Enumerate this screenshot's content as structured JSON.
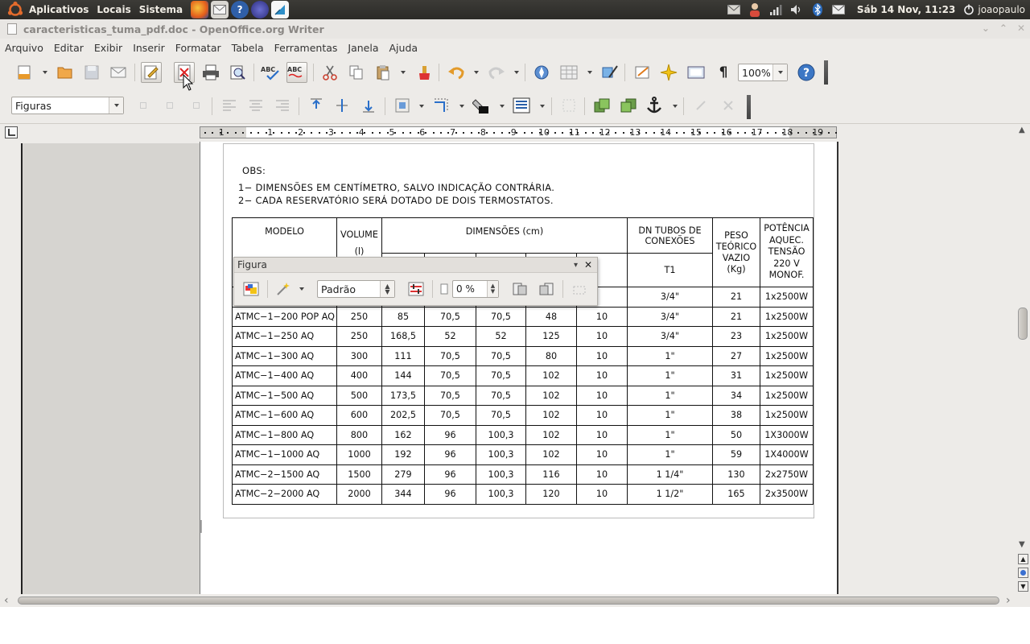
{
  "top_panel": {
    "menus": [
      "Aplicativos",
      "Locais",
      "Sistema"
    ],
    "datetime": "Sáb 14 Nov, 11:23",
    "user": "joaopaulo"
  },
  "window": {
    "title": "caracteristicas_tuma_pdf.doc - OpenOffice.org Writer"
  },
  "menubar": [
    "Arquivo",
    "Editar",
    "Exibir",
    "Inserir",
    "Formatar",
    "Tabela",
    "Ferramentas",
    "Janela",
    "Ajuda"
  ],
  "toolbar": {
    "zoom": "100%"
  },
  "frame_toolbar": {
    "style_value": "Figuras"
  },
  "ruler": {
    "numbers": [
      "1",
      "1",
      "2",
      "3",
      "4",
      "5",
      "6",
      "7",
      "8",
      "9",
      "10",
      "11",
      "12",
      "13",
      "14",
      "15",
      "16",
      "17",
      "18",
      "19"
    ]
  },
  "document": {
    "obs_title": "OBS:",
    "obs_lines": [
      "1− DIMENSÕES EM CENTÍMETRO, SALVO INDICAÇÃO CONTRÁRIA.",
      "2− CADA RESERVATÓRIO SERÁ DOTADO DE DOIS TERMOSTATOS."
    ],
    "headers": {
      "modelo": "MODELO",
      "volume": "VOLUME",
      "volume_unit": "(l)",
      "dimensoes": "DIMENSÕES (cm)",
      "dn_tubos": "DN TUBOS DE CONEXÕES",
      "t1": "T1",
      "peso": "PESO TEÓRICO VAZIO (Kg)",
      "potencia": "POTÊNCIA AQUEC. TENSÃO 220 V MONOF."
    },
    "rows": [
      [
        "",
        "",
        "",
        "",
        "",
        "",
        "",
        "3/4\"",
        "21",
        "1x2500W"
      ],
      [
        "ATMC−1−200 POP AQ",
        "250",
        "85",
        "70,5",
        "70,5",
        "48",
        "10",
        "3/4\"",
        "21",
        "1x2500W"
      ],
      [
        "ATMC−1−250 AQ",
        "250",
        "168,5",
        "52",
        "52",
        "125",
        "10",
        "3/4\"",
        "23",
        "1x2500W"
      ],
      [
        "ATMC−1−300 AQ",
        "300",
        "111",
        "70,5",
        "70,5",
        "80",
        "10",
        "1\"",
        "27",
        "1x2500W"
      ],
      [
        "ATMC−1−400 AQ",
        "400",
        "144",
        "70,5",
        "70,5",
        "102",
        "10",
        "1\"",
        "31",
        "1x2500W"
      ],
      [
        "ATMC−1−500 AQ",
        "500",
        "173,5",
        "70,5",
        "70,5",
        "102",
        "10",
        "1\"",
        "34",
        "1x2500W"
      ],
      [
        "ATMC−1−600 AQ",
        "600",
        "202,5",
        "70,5",
        "70,5",
        "102",
        "10",
        "1\"",
        "38",
        "1x2500W"
      ],
      [
        "ATMC−1−800 AQ",
        "800",
        "162",
        "96",
        "100,3",
        "102",
        "10",
        "1\"",
        "50",
        "1X3000W"
      ],
      [
        "ATMC−1−1000 AQ",
        "1000",
        "192",
        "96",
        "100,3",
        "102",
        "10",
        "1\"",
        "59",
        "1X4000W"
      ],
      [
        "ATMC−2−1500 AQ",
        "1500",
        "279",
        "96",
        "100,3",
        "116",
        "10",
        "1 1/4\"",
        "130",
        "2x2750W"
      ],
      [
        "ATMC−2−2000 AQ",
        "2000",
        "344",
        "96",
        "100,3",
        "120",
        "10",
        "1 1/2\"",
        "165",
        "2x3500W"
      ]
    ]
  },
  "figure_toolbar": {
    "title": "Figura",
    "mode_value": "Padrão",
    "transparency_value": "0 %"
  }
}
